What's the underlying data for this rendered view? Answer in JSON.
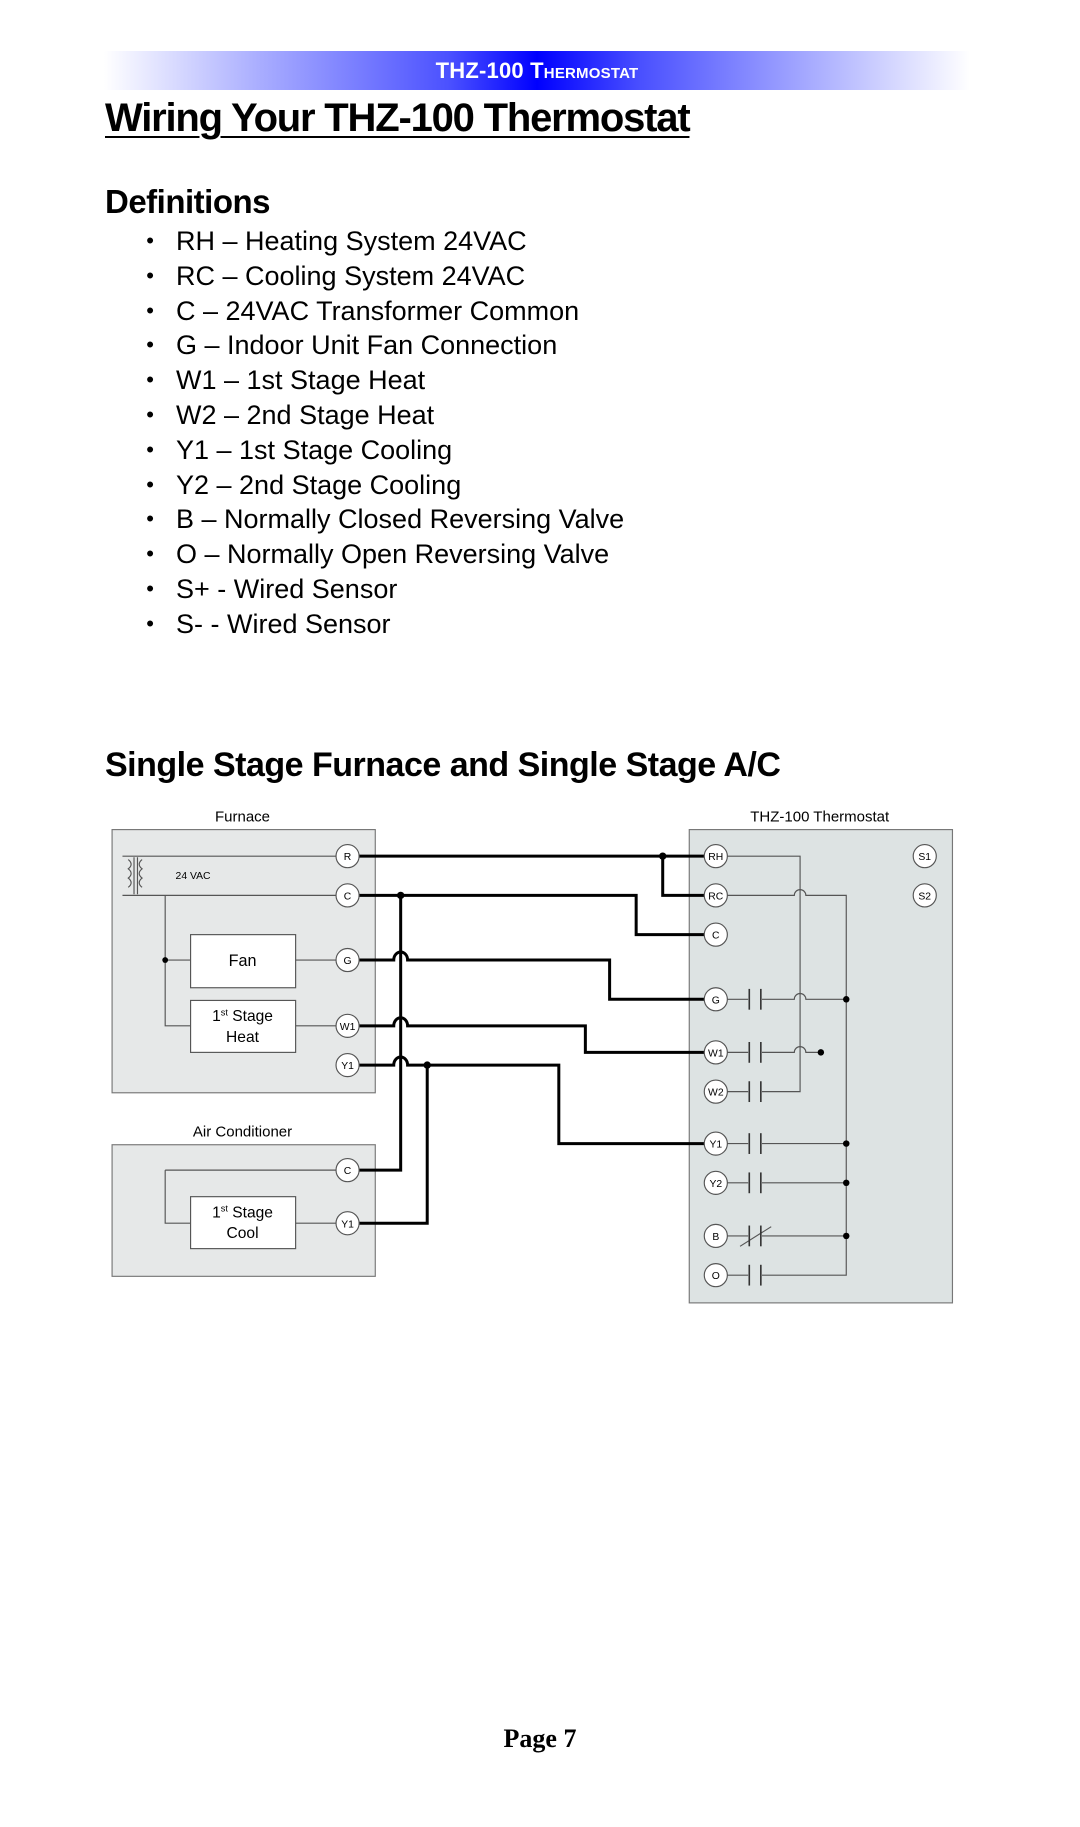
{
  "header": {
    "running_title": "THZ-100 Thermostat",
    "bar_color": "#0000ff"
  },
  "title": "Wiring Your THZ-100 Thermostat",
  "definitions": {
    "heading": "Definitions",
    "items": [
      "RH – Heating System 24VAC",
      "RC – Cooling System 24VAC",
      "C – 24VAC Transformer Common",
      "G – Indoor Unit Fan Connection",
      "W1 – 1st Stage Heat",
      "W2 – 2nd Stage Heat",
      "Y1 – 1st Stage Cooling",
      "Y2 – 2nd Stage Cooling",
      "B – Normally Closed Reversing Valve",
      "O – Normally Open Reversing Valve",
      "S+ - Wired Sensor",
      "S- - Wired Sensor"
    ]
  },
  "section_heading": "Single Stage Furnace and Single Stage A/C",
  "diagram": {
    "furnace": {
      "label": "Furnace",
      "transformer": "24 VAC",
      "fan": "Fan",
      "heat": [
        "1",
        "st",
        " Stage",
        "Heat"
      ],
      "terminals": [
        "R",
        "C",
        "G",
        "W1",
        "Y1"
      ]
    },
    "air_conditioner": {
      "label": "Air Conditioner",
      "cool": [
        "1",
        "st",
        " Stage",
        "Cool"
      ],
      "terminals": [
        "C",
        "Y1"
      ]
    },
    "thermostat": {
      "label": "THZ-100 Thermostat",
      "terminals": [
        "RH",
        "RC",
        "C",
        "G",
        "W1",
        "W2",
        "Y1",
        "Y2",
        "B",
        "O"
      ],
      "sensor_terminals": [
        "S1",
        "S2"
      ]
    }
  },
  "footer": {
    "page": "Page 7"
  }
}
